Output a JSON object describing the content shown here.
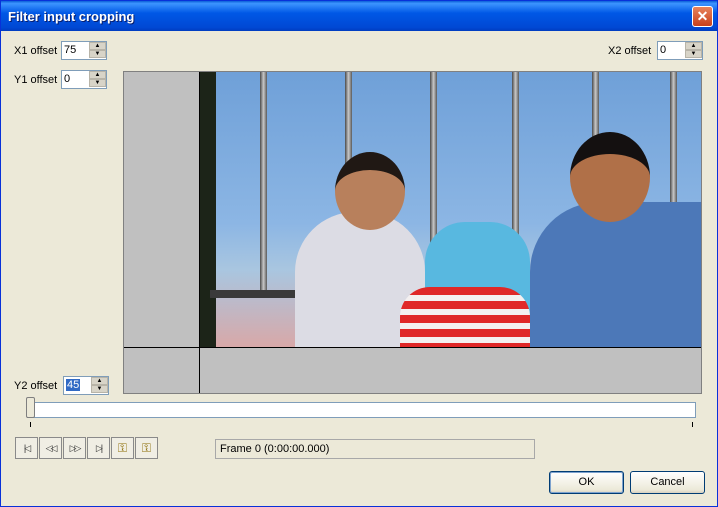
{
  "window": {
    "title": "Filter input cropping",
    "close_glyph": "✕"
  },
  "offsets": {
    "x1": {
      "label": "X1 offset",
      "value": "75"
    },
    "x2": {
      "label": "X2 offset",
      "value": "0"
    },
    "y1": {
      "label": "Y1 offset",
      "value": "0"
    },
    "y2": {
      "label": "Y2 offset",
      "value": "45"
    }
  },
  "spinner": {
    "up": "▲",
    "down": "▼"
  },
  "transport": {
    "start": "|◁",
    "prev": "◁◁",
    "next": "▷▷",
    "end": "▷|",
    "key_prev": "⚿",
    "key_next": "⚿"
  },
  "frame_info": "Frame 0 (0:00:00.000)",
  "timeline": {
    "position": 0
  },
  "buttons": {
    "ok": "OK",
    "cancel": "Cancel"
  },
  "icons": {
    "start": "go-to-start-icon",
    "prev": "step-back-icon",
    "next": "step-forward-icon",
    "end": "go-to-end-icon",
    "key_prev": "prev-keyframe-icon",
    "key_next": "next-keyframe-icon"
  }
}
